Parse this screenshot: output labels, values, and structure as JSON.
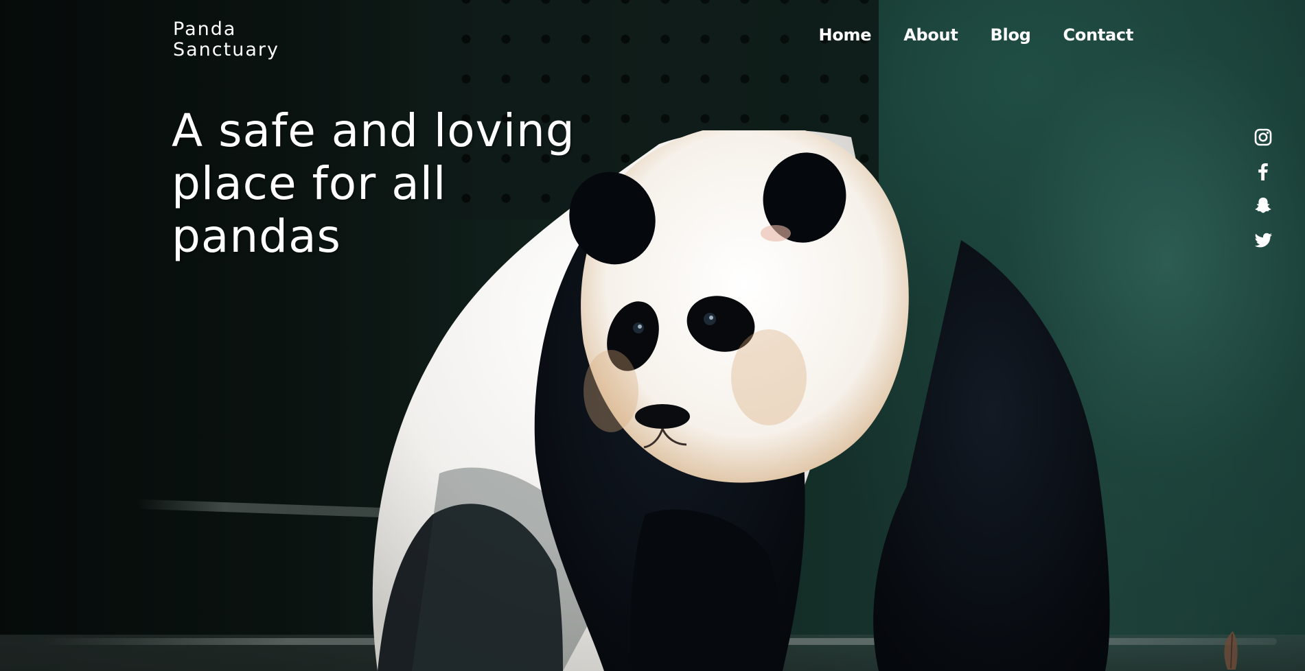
{
  "site": {
    "logo_line1": "Panda",
    "logo_line2": "Sanctuary"
  },
  "nav": {
    "items": [
      {
        "label": "Home"
      },
      {
        "label": "About"
      },
      {
        "label": "Blog"
      },
      {
        "label": "Contact"
      }
    ]
  },
  "hero": {
    "headline": "A safe and loving place for all pandas"
  },
  "social": {
    "icons": [
      "instagram-icon",
      "facebook-icon",
      "snapchat-icon",
      "twitter-icon"
    ]
  },
  "colors": {
    "text": "#ffffff",
    "background_dark": "#0b1512",
    "foliage_green": "#1d3f37"
  }
}
